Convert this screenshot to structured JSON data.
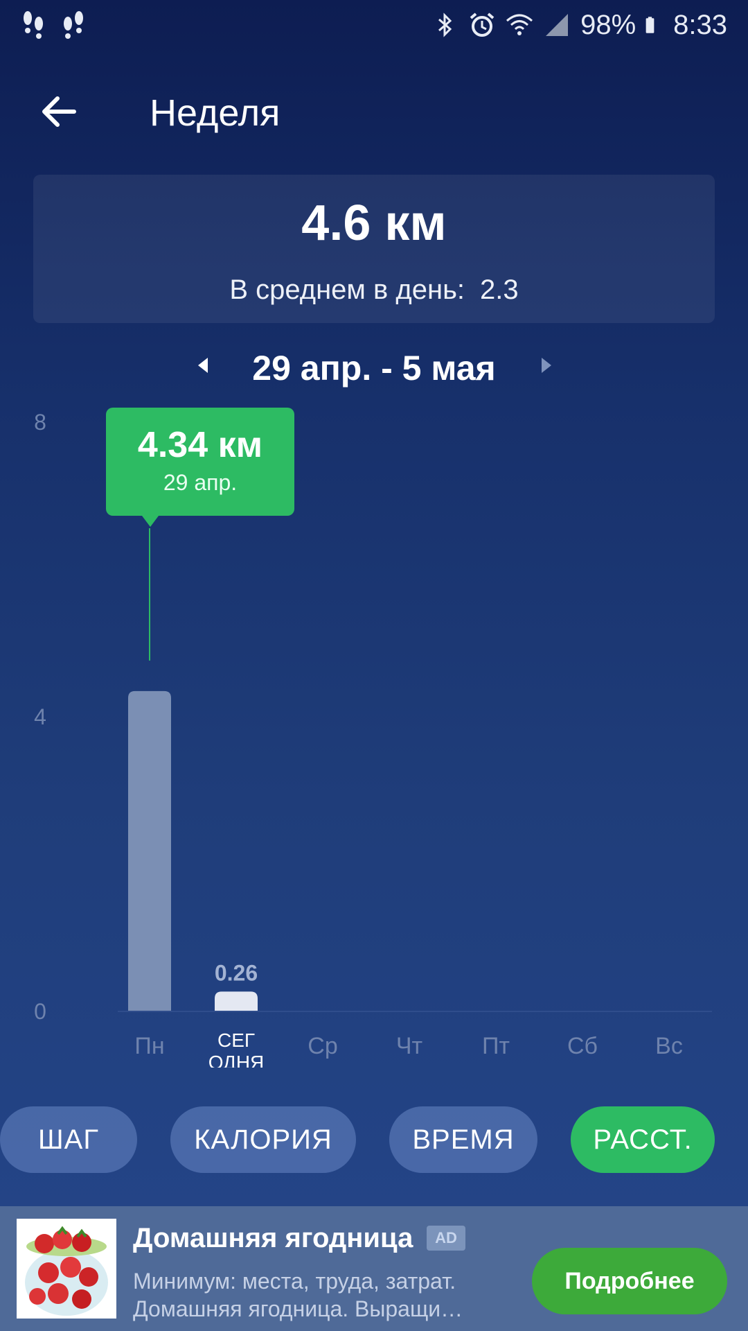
{
  "status_bar": {
    "battery": "98%",
    "time": "8:33",
    "icons": [
      "footprints-icon",
      "footprints-icon",
      "bluetooth-icon",
      "alarm-icon",
      "wifi-icon",
      "signal-icon",
      "battery-icon"
    ]
  },
  "app_bar": {
    "back_icon": "arrow-left-icon",
    "title": "Неделя"
  },
  "summary": {
    "total": "4.6 км",
    "average_label": "В среднем в день:",
    "average_value": "2.3"
  },
  "date_range": {
    "label": "29 апр. - 5 мая",
    "prev_icon": "triangle-left-icon",
    "next_icon": "triangle-right-icon"
  },
  "tooltip": {
    "value": "4.34 км",
    "date": "29 апр."
  },
  "chart_data": {
    "type": "bar",
    "categories": [
      "Пн",
      "СЕГ ОДНЯ",
      "Ср",
      "Чт",
      "Пт",
      "Сб",
      "Вс"
    ],
    "category_lines": [
      [
        "Пн"
      ],
      [
        "СЕГ",
        "ОДНЯ"
      ],
      [
        "Ср"
      ],
      [
        "Чт"
      ],
      [
        "Пт"
      ],
      [
        "Сб"
      ],
      [
        "Вс"
      ]
    ],
    "values": [
      4.34,
      0.26,
      0,
      0,
      0,
      0,
      0
    ],
    "value_labels": [
      "",
      "0.26",
      "",
      "",
      "",
      "",
      ""
    ],
    "y_ticks": [
      0,
      4,
      8
    ],
    "ylim": [
      0,
      8
    ],
    "selected_index": 0,
    "highlight_index": 1,
    "colors": {
      "bar": "#7b8fb4",
      "highlight_bar": "#e4e8f2",
      "tick": "#6f83ad",
      "category": "#6f83ad",
      "highlight_category": "#ffffff",
      "marker_line": "#2dbb63"
    }
  },
  "metric_tabs": [
    {
      "label": "ШАГ",
      "active": false
    },
    {
      "label": "КАЛОРИЯ",
      "active": false
    },
    {
      "label": "ВРЕМЯ",
      "active": false
    },
    {
      "label": "РАССТ.",
      "active": true
    }
  ],
  "ad": {
    "title": "Домашняя ягодница",
    "badge": "AD",
    "description_line1": "Минимум: места, труда, затрат.",
    "description_line2": "Домашняя ягодница. Выращи…",
    "cta": "Подробнее"
  }
}
